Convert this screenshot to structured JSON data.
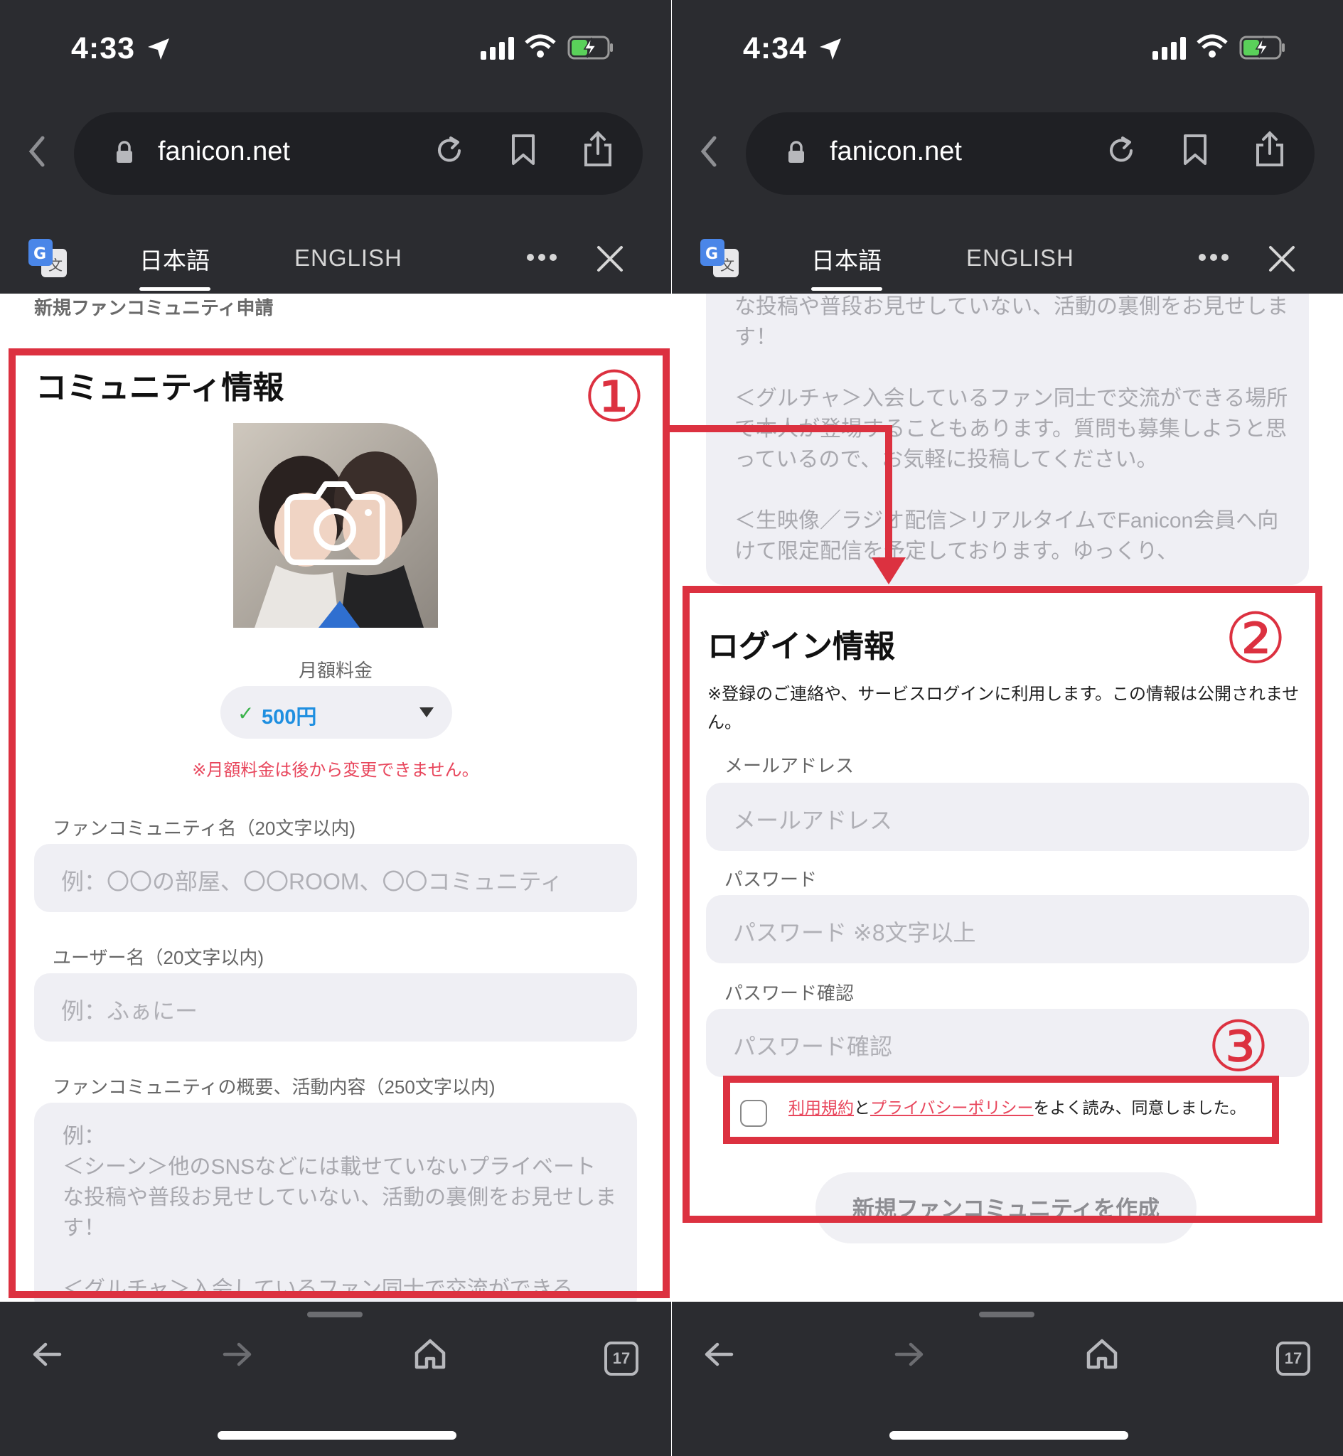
{
  "left": {
    "status": {
      "time": "4:33"
    },
    "browser": {
      "host": "fanicon.net",
      "tab_ja": "日本語",
      "tab_en": "ENGLISH",
      "tab_count": "17"
    },
    "breadcrumb": "新規ファンコミュニティ申請",
    "section_title": "コミュニティ情報",
    "fee_label": "月額料金",
    "fee_check": "✓",
    "fee_value": "500円",
    "fee_warning": "※月額料金は後から変更できません。",
    "name_label": "ファンコミュニティ名（20文字以内)",
    "name_placeholder": "例：〇〇の部屋、〇〇ROOM、〇〇コミュニティ",
    "user_label": "ユーザー名（20文字以内)",
    "user_placeholder": "例：ふぁにー",
    "desc_label": "ファンコミュニティの概要、活動内容（250文字以内)",
    "desc_placeholder": "例：\n＜シーン＞他のSNSなどには載せていないプライベートな投稿や普段お見せしていない、活動の裏側をお見せします！\n\n＜グルチャ＞入会しているファン同士で交流ができる"
  },
  "right": {
    "status": {
      "time": "4:34"
    },
    "browser": {
      "host": "fanicon.net",
      "tab_ja": "日本語",
      "tab_en": "ENGLISH",
      "tab_count": "17"
    },
    "desc_text": "＜シーン＞他のSNSなどには載せていないプライベートな投稿や普段お見せしていない、活動の裏側をお見せします！\n\n＜グルチャ＞入会しているファン同士で交流ができる場所で本人が登場することもあります。質問も募集しようと思っているので、お気軽に投稿してください。\n\n＜生映像／ラジオ配信＞リアルタイムでFanicon会員へ向けて限定配信を予定しております。ゆっくり、",
    "section_title": "ログイン情報",
    "note": "※登録のご連絡や、サービスログインに利用します。この情報は公開されません。",
    "email_label": "メールアドレス",
    "email_placeholder": "メールアドレス",
    "password_label": "パスワード",
    "password_placeholder": "パスワード ※8文字以上",
    "confirm_label": "パスワード確認",
    "confirm_placeholder": "パスワード確認",
    "agree_terms": "利用規約",
    "agree_and": "と",
    "agree_privacy": "プライバシーポリシー",
    "agree_rest": "をよく読み、同意しました。",
    "submit_label": "新規ファンコミュニティを作成"
  },
  "annotations": {
    "one": "①",
    "two": "②",
    "three": "③"
  },
  "colors": {
    "annotation_red": "#dc3140",
    "browser_dark": "#2b2c30",
    "link_red": "#e8465c",
    "price_blue": "#1f8fe0",
    "check_green": "#3ab24a"
  },
  "icons": [
    "location-arrow-icon",
    "signal-icon",
    "wifi-icon",
    "battery-charging-icon",
    "chevron-left-icon",
    "lock-icon",
    "reload-icon",
    "bookmark-icon",
    "share-icon",
    "google-translate-icon",
    "more-icon",
    "close-icon",
    "camera-icon",
    "caret-down-icon",
    "arrow-left-icon",
    "arrow-right-icon",
    "home-icon",
    "tabs-icon"
  ]
}
